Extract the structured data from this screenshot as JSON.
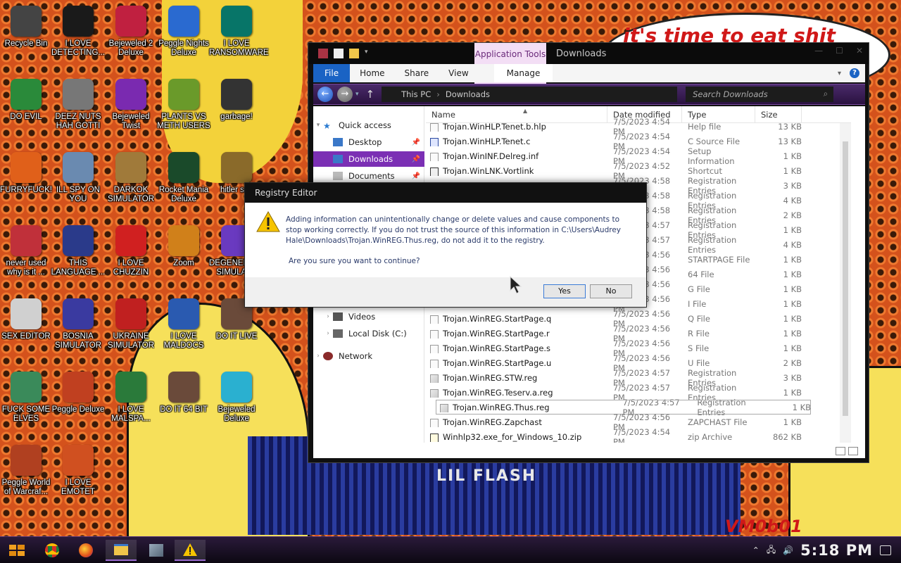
{
  "wallpaper": {
    "bubble_text": "it's time to eat shit",
    "poster_text": "LIL FLASH",
    "signature": "VM0b01"
  },
  "desktop_icons": [
    {
      "label": "Recycle Bin",
      "icon": "recycle-bin-icon",
      "color": "#444444"
    },
    {
      "label": "I LOVE DETECTING...",
      "icon": "de-icon",
      "color": "#1a1a1a"
    },
    {
      "label": "Bejeweled 2 Deluxe",
      "icon": "bejeweled2-icon",
      "color": "#c02040"
    },
    {
      "label": "Peggle Nights Deluxe",
      "icon": "peggle-nights-icon",
      "color": "#2a6ad0"
    },
    {
      "label": "I LOVE RANSOMWARE",
      "icon": "publisher-icon",
      "color": "#077568"
    },
    {
      "label": "DO EVIL",
      "icon": "chrome-icon",
      "color": "#2a8a3a"
    },
    {
      "label": "DEEZ NUTS HAH GOTTI",
      "icon": "copy-icon",
      "color": "#777777"
    },
    {
      "label": "Bejeweled Twist",
      "icon": "bejeweled-twist-icon",
      "color": "#7a2ab0"
    },
    {
      "label": "PLANTS VS METH USERS",
      "icon": "pvz-icon",
      "color": "#6a9a2a"
    },
    {
      "label": "garbage!",
      "icon": "garbage-icon",
      "color": "#333333"
    },
    {
      "label": "FURRYFUCK!",
      "icon": "firefox-icon",
      "color": "#e0601a"
    },
    {
      "label": "ILL SPY ON YOU",
      "icon": "remote-desktop-icon",
      "color": "#6a8ab0"
    },
    {
      "label": "DARKOK SIMULATOR",
      "icon": "money-bag-icon",
      "color": "#a07a3a"
    },
    {
      "label": "Rocket Mania Deluxe",
      "icon": "rocket-mania-icon",
      "color": "#1a4a2a"
    },
    {
      "label": "hitler sim",
      "icon": "coin-icon",
      "color": "#8a6a2a"
    },
    {
      "label": "never used why is it ...",
      "icon": "devcpp-icon",
      "color": "#c0303a"
    },
    {
      "label": "THIS LANGUAGE ...",
      "icon": "goland-icon",
      "color": "#2a3a8a"
    },
    {
      "label": "I LOVE CHUZZIN",
      "icon": "chuzzle-icon",
      "color": "#d02020"
    },
    {
      "label": "Zoom",
      "icon": "zoom-icon",
      "color": "#d0801a"
    },
    {
      "label": "DEGENERATE SIMULAT...",
      "icon": "degenerate-icon",
      "color": "#6a3ac0"
    },
    {
      "label": "SEX EDITOR",
      "icon": "hxd-icon",
      "color": "#d0d0d0"
    },
    {
      "label": "BOSNIA SIMULATOR",
      "icon": "mine-icon",
      "color": "#3a3aa0"
    },
    {
      "label": "UKRAINE SIMULATOR",
      "icon": "radiation-icon",
      "color": "#c02020"
    },
    {
      "label": "I LOVE MALDOCS",
      "icon": "word-icon",
      "color": "#2a5ab0"
    },
    {
      "label": "DO IT LIVE",
      "icon": "portrait-icon",
      "color": "#6a4a3a"
    },
    {
      "label": "FUCK SOME ELVES",
      "icon": "elf-icon",
      "color": "#3a8a5a"
    },
    {
      "label": "Peggle Deluxe",
      "icon": "peggle-icon",
      "color": "#c04020"
    },
    {
      "label": "I LOVE MALSPA...",
      "icon": "excel-icon",
      "color": "#2a7a3a"
    },
    {
      "label": "DO IT 64 BIT",
      "icon": "portrait-64-icon",
      "color": "#6a4a3a"
    },
    {
      "label": "Bejeweled Deluxe",
      "icon": "gem-icon",
      "color": "#2ab0d0"
    },
    {
      "label": "Peggle World of Warcraf...",
      "icon": "peggle-wow-icon",
      "color": "#b04020"
    },
    {
      "label": "I LOVE EMOTET",
      "icon": "powerpoint-icon",
      "color": "#d05020"
    }
  ],
  "explorer": {
    "title": "Downloads",
    "app_tools": "Application Tools",
    "ribbon_tabs": [
      "File",
      "Home",
      "Share",
      "View",
      "Manage"
    ],
    "path": [
      "This PC",
      "Downloads"
    ],
    "search_placeholder": "Search Downloads",
    "columns": [
      "Name",
      "Date modified",
      "Type",
      "Size"
    ],
    "nav": {
      "quick_access": "Quick access",
      "desktop": "Desktop",
      "downloads": "Downloads",
      "documents": "Documents",
      "videos": "Videos",
      "local_disk": "Local Disk (C:)",
      "network": "Network"
    },
    "files": [
      {
        "name": "Trojan.WinHLP.Tenet.b.hlp",
        "date": "7/5/2023 4:54 PM",
        "type": "Help file",
        "size": "13 KB",
        "icon": "help"
      },
      {
        "name": "Trojan.WinHLP.Tenet.c",
        "date": "7/5/2023 4:54 PM",
        "type": "C Source File",
        "size": "13 KB",
        "icon": "c"
      },
      {
        "name": "Trojan.WinINF.Delreg.inf",
        "date": "7/5/2023 4:54 PM",
        "type": "Setup Information",
        "size": "1 KB",
        "icon": "inf"
      },
      {
        "name": "Trojan.WinLNK.Vortlink",
        "date": "7/5/2023 4:52 PM",
        "type": "Shortcut",
        "size": "1 KB",
        "icon": "lnk"
      },
      {
        "name": "",
        "date": "7/5/2023 4:58 PM",
        "type": "Registration Entries",
        "size": "3 KB",
        "icon": "reg"
      },
      {
        "name": "",
        "date": "7/5/2023 4:58 PM",
        "type": "Registration Entries",
        "size": "4 KB",
        "icon": "reg"
      },
      {
        "name": "",
        "date": "7/5/2023 4:58 PM",
        "type": "Registration Entries",
        "size": "2 KB",
        "icon": "reg"
      },
      {
        "name": "",
        "date": "7/5/2023 4:57 PM",
        "type": "Registration Entries",
        "size": "1 KB",
        "icon": "reg"
      },
      {
        "name": "",
        "date": "7/5/2023 4:57 PM",
        "type": "Registration Entries",
        "size": "4 KB",
        "icon": "reg"
      },
      {
        "name": "",
        "date": "7/5/2023 4:56 PM",
        "type": "STARTPAGE File",
        "size": "1 KB",
        "icon": "file"
      },
      {
        "name": "",
        "date": "7/5/2023 4:56 PM",
        "type": "64 File",
        "size": "1 KB",
        "icon": "file"
      },
      {
        "name": "",
        "date": "7/5/2023 4:56 PM",
        "type": "G File",
        "size": "1 KB",
        "icon": "file"
      },
      {
        "name": "",
        "date": "7/5/2023 4:56 PM",
        "type": "I File",
        "size": "1 KB",
        "icon": "file"
      },
      {
        "name": "Trojan.WinREG.StartPage.q",
        "date": "7/5/2023 4:56 PM",
        "type": "Q File",
        "size": "1 KB",
        "icon": "file"
      },
      {
        "name": "Trojan.WinREG.StartPage.r",
        "date": "7/5/2023 4:56 PM",
        "type": "R File",
        "size": "1 KB",
        "icon": "file"
      },
      {
        "name": "Trojan.WinREG.StartPage.s",
        "date": "7/5/2023 4:56 PM",
        "type": "S File",
        "size": "1 KB",
        "icon": "file"
      },
      {
        "name": "Trojan.WinREG.StartPage.u",
        "date": "7/5/2023 4:56 PM",
        "type": "U File",
        "size": "2 KB",
        "icon": "file"
      },
      {
        "name": "Trojan.WinREG.STW.reg",
        "date": "7/5/2023 4:57 PM",
        "type": "Registration Entries",
        "size": "3 KB",
        "icon": "reg"
      },
      {
        "name": "Trojan.WinREG.Teserv.a.reg",
        "date": "7/5/2023 4:57 PM",
        "type": "Registration Entries",
        "size": "1 KB",
        "icon": "reg"
      },
      {
        "name": "Trojan.WinREG.Thus.reg",
        "date": "7/5/2023 4:57 PM",
        "type": "Registration Entries",
        "size": "1 KB",
        "icon": "reg",
        "selected": true
      },
      {
        "name": "Trojan.WinREG.Zapchast",
        "date": "7/5/2023 4:56 PM",
        "type": "ZAPCHAST File",
        "size": "1 KB",
        "icon": "file"
      },
      {
        "name": "Winhlp32.exe_for_Windows_10.zip",
        "date": "7/5/2023 4:54 PM",
        "type": "zip Archive",
        "size": "862 KB",
        "icon": "zip"
      }
    ]
  },
  "dialog": {
    "title": "Registry Editor",
    "message": "Adding information can unintentionally change or delete values and cause components to stop working correctly. If you do not trust the source of this information in C:\\Users\\Audrey Hale\\Downloads\\Trojan.WinREG.Thus.reg, do not add it to the registry.",
    "question": "Are you sure you want to continue?",
    "yes": "Yes",
    "no": "No"
  },
  "taskbar": {
    "clock": "5:18 PM"
  }
}
